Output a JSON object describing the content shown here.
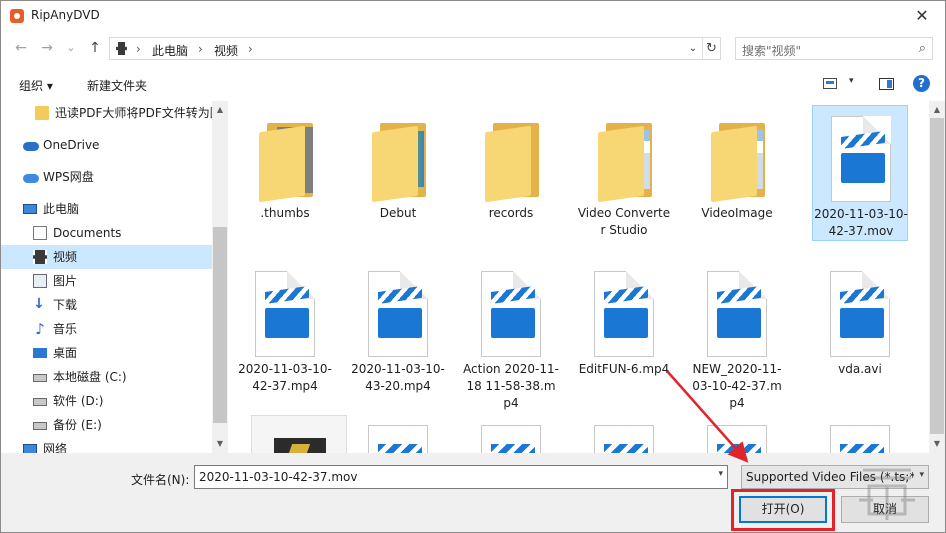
{
  "window": {
    "title": "RipAnyDVD",
    "close_glyph": "✕"
  },
  "nav": {
    "back": "←",
    "forward": "→",
    "recent": "⌄",
    "up": "↑",
    "refresh": "↻",
    "dropdown": "⌄"
  },
  "breadcrumb": {
    "sep": "›",
    "items": [
      "此电脑",
      "视频"
    ]
  },
  "search": {
    "placeholder": "搜索\"视频\"",
    "icon": "⌕"
  },
  "toolbar": {
    "organize": "组织 ▾",
    "new_folder": "新建文件夹",
    "help": "?",
    "view_dd": "▾"
  },
  "sidebar": {
    "items": [
      {
        "label": "迅读PDF大师将PDF文件转为图",
        "icon": "folder-icon",
        "selected": false
      },
      {
        "label": "OneDrive",
        "icon": "cloud-icon",
        "selected": false
      },
      {
        "label": "WPS网盘",
        "icon": "wps-cloud-icon",
        "selected": false
      },
      {
        "label": "此电脑",
        "icon": "computer-icon",
        "selected": false
      },
      {
        "label": "Documents",
        "icon": "documents-icon",
        "selected": false
      },
      {
        "label": "视频",
        "icon": "video-icon",
        "selected": true
      },
      {
        "label": "图片",
        "icon": "pictures-icon",
        "selected": false
      },
      {
        "label": "下载",
        "icon": "download-icon",
        "selected": false
      },
      {
        "label": "音乐",
        "icon": "music-icon",
        "selected": false
      },
      {
        "label": "桌面",
        "icon": "desktop-icon",
        "selected": false
      },
      {
        "label": "本地磁盘 (C:)",
        "icon": "drive-icon",
        "selected": false
      },
      {
        "label": "软件 (D:)",
        "icon": "drive-icon",
        "selected": false
      },
      {
        "label": "备份 (E:)",
        "icon": "drive-icon",
        "selected": false
      },
      {
        "label": "网络",
        "icon": "network-icon",
        "selected": false
      }
    ],
    "scroll_up": "▲",
    "scroll_down": "▼"
  },
  "files": [
    {
      "name": ".thumbs",
      "kind": "folder-gray"
    },
    {
      "name": "Debut",
      "kind": "folder-color"
    },
    {
      "name": "records",
      "kind": "folder"
    },
    {
      "name": "Video Converter Studio",
      "kind": "folder-doc"
    },
    {
      "name": "VideoImage",
      "kind": "folder-doc"
    },
    {
      "name": "2020-11-03-10-42-37.mov",
      "kind": "video",
      "selected": true
    },
    {
      "name": "2020-11-03-10-42-37.mp4",
      "kind": "video"
    },
    {
      "name": "2020-11-03-10-43-20.mp4",
      "kind": "video"
    },
    {
      "name": "Action 2020-11-18 11-58-38.mp4",
      "kind": "video"
    },
    {
      "name": "EditFUN-6.mp4",
      "kind": "video"
    },
    {
      "name": "NEW_2020-11-03-10-42-37.mp4",
      "kind": "video"
    },
    {
      "name": "vda.avi",
      "kind": "video"
    }
  ],
  "footer": {
    "filename_label": "文件名(N):",
    "filename_value": "2020-11-03-10-42-37.mov",
    "filter_value": "Supported Video Files (*.ts;*",
    "open": "打开(O)",
    "cancel": "取消",
    "dd": "▾"
  },
  "colors": {
    "accent": "#0078d7",
    "selection": "#cce8ff",
    "highlight": "#e0242a"
  }
}
